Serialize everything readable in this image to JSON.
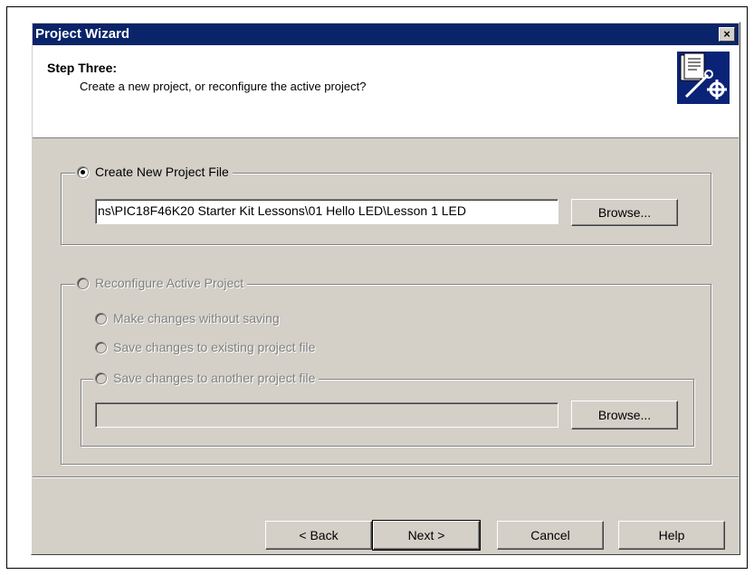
{
  "window": {
    "title": "Project Wizard",
    "close_glyph": "×"
  },
  "header": {
    "step_title": "Step Three:",
    "step_subtitle": "Create a new project, or reconfigure the active project?",
    "icon": "wizard-document-wrench-gear-icon"
  },
  "create_group": {
    "label": "Create New Project File",
    "path_value": "ns\\PIC18F46K20 Starter Kit Lessons\\01 Hello LED\\Lesson 1 LED",
    "browse_label": "Browse..."
  },
  "reconfigure_group": {
    "label": "Reconfigure Active Project",
    "option_no_save": "Make changes without saving",
    "option_save_existing": "Save changes to existing project file",
    "option_save_another": "Save changes to another project file",
    "another_path_value": "",
    "browse_label": "Browse..."
  },
  "footer": {
    "back_label": "< Back",
    "next_label": "Next >",
    "cancel_label": "Cancel",
    "help_label": "Help"
  }
}
